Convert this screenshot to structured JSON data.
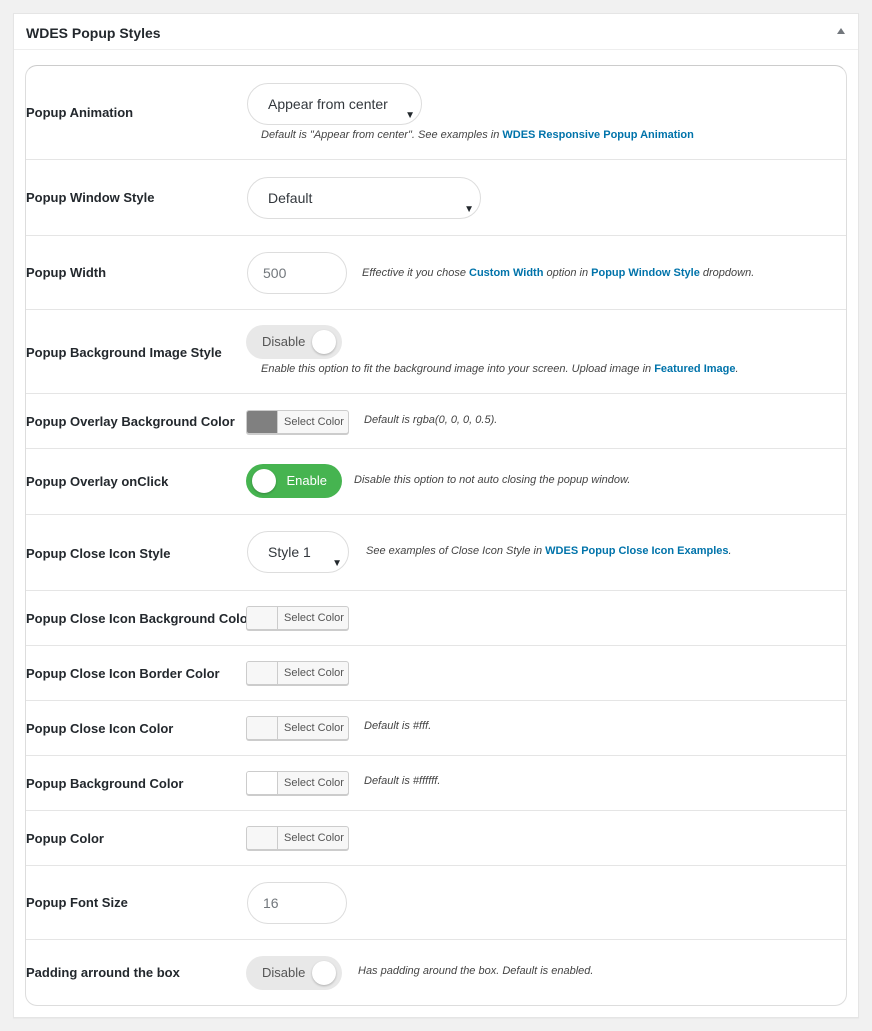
{
  "panel": {
    "title": "WDES Popup Styles"
  },
  "rows": {
    "animation": {
      "label": "Popup Animation",
      "value": "Appear from center",
      "desc_prefix": "Default is \"Appear from center\". See examples in ",
      "desc_link": "WDES Responsive Popup Animation"
    },
    "window_style": {
      "label": "Popup Window Style",
      "value": "Default"
    },
    "width": {
      "label": "Popup Width",
      "placeholder": "500",
      "desc_1": "Effective it you chose ",
      "link_1": "Custom Width",
      "desc_2": " option in ",
      "link_2": "Popup Window Style",
      "desc_3": " dropdown."
    },
    "bg_image_style": {
      "label": "Popup Background Image Style",
      "toggle": "Disable",
      "desc_prefix": "Enable this option to fit the background image into your screen. Upload image in ",
      "desc_link": "Featured Image",
      "desc_suffix": "."
    },
    "overlay_bg": {
      "label": "Popup Overlay Background Color",
      "button": "Select Color",
      "swatch": "#808080",
      "desc": "Default is rgba(0, 0, 0, 0.5)."
    },
    "overlay_onclick": {
      "label": "Popup Overlay onClick",
      "toggle": "Enable",
      "desc": "Disable this option to not auto closing the popup window."
    },
    "close_icon_style": {
      "label": "Popup Close Icon Style",
      "value": "Style 1",
      "desc_prefix": "See examples of Close Icon Style in ",
      "desc_link": "WDES Popup Close Icon Examples",
      "desc_suffix": "."
    },
    "close_icon_bg": {
      "label": "Popup Close Icon Background Color",
      "button": "Select Color",
      "swatch": "#f7f7f7"
    },
    "close_icon_border": {
      "label": "Popup Close Icon Border Color",
      "button": "Select Color",
      "swatch": "#f7f7f7"
    },
    "close_icon_color": {
      "label": "Popup Close Icon Color",
      "button": "Select Color",
      "swatch": "#f7f7f7",
      "desc": "Default is #fff."
    },
    "bg_color": {
      "label": "Popup Background Color",
      "button": "Select Color",
      "swatch": "#ffffff",
      "desc": "Default is #ffffff."
    },
    "color": {
      "label": "Popup Color",
      "button": "Select Color",
      "swatch": "#f7f7f7"
    },
    "font_size": {
      "label": "Popup Font Size",
      "placeholder": "16"
    },
    "padding": {
      "label": "Padding arround the box",
      "toggle": "Disable",
      "desc": "Has padding around the box. Default is enabled."
    }
  },
  "colors": {
    "link": "#0073aa",
    "toggle_on": "#46b450",
    "toggle_off": "#e8e8e8"
  }
}
